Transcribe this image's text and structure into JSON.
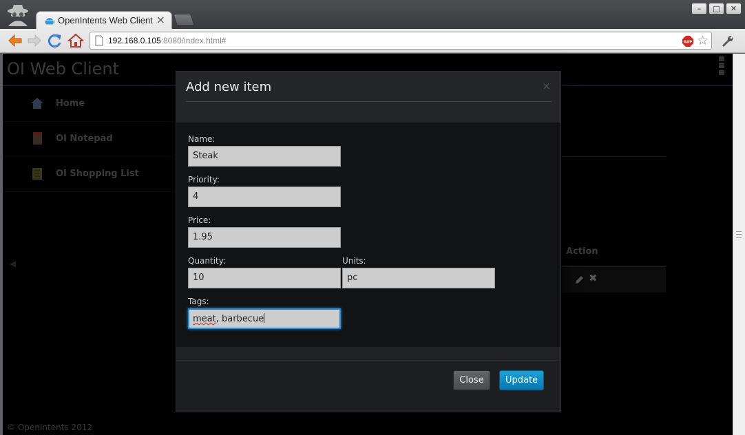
{
  "browser": {
    "tab_title": "OpenIntents Web Client",
    "tab_close": "×",
    "url_host": "192.168.0.105",
    "url_rest": ":8080/index.html#",
    "window_buttons": [
      "–",
      "□",
      "✕"
    ],
    "icons": [
      "incognito-icon",
      "android-favicon",
      "back-arrow-icon",
      "forward-arrow-icon",
      "reload-icon",
      "home-icon",
      "page-icon",
      "adblock-icon",
      "star-icon",
      "wrench-icon"
    ]
  },
  "app": {
    "title": "OI Web Client",
    "footer": "© OpenIntents 2012",
    "accent_color": "#1f8ad6"
  },
  "sidebar": {
    "items": [
      {
        "label": "Home",
        "icon": "home-icon"
      },
      {
        "label": "OI Notepad",
        "icon": "notepad-icon"
      },
      {
        "label": "OI Shopping List",
        "icon": "shopping-list-icon"
      }
    ]
  },
  "background_table": {
    "action_header": "Action",
    "row_icons": [
      "edit-icon",
      "delete-icon"
    ],
    "delete_glyph": "✖"
  },
  "modal": {
    "title": "Add new item",
    "close_glyph": "×",
    "fields": {
      "name": {
        "label": "Name:",
        "value": "Steak"
      },
      "priority": {
        "label": "Priority:",
        "value": "4"
      },
      "price": {
        "label": "Price:",
        "value": "1.95"
      },
      "quantity": {
        "label": "Quantity:",
        "value": "10"
      },
      "units": {
        "label": "Units:",
        "value": "pc"
      },
      "tags": {
        "label": "Tags:",
        "value_word1": "meat",
        "value_rest": ", barbecue"
      }
    },
    "buttons": {
      "close": "Close",
      "update": "Update",
      "update_color": "#0f8bc4"
    }
  }
}
